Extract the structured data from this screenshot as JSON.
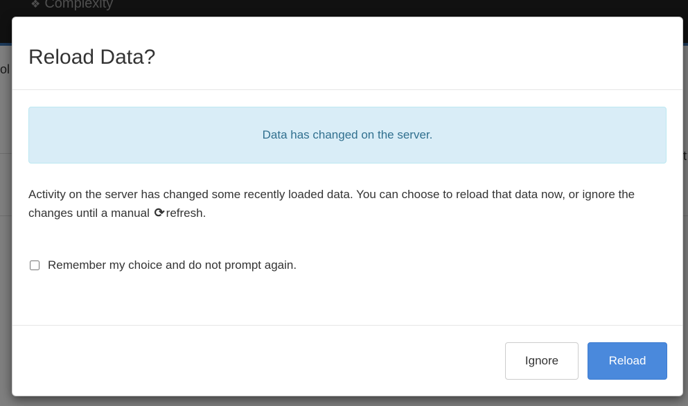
{
  "background": {
    "app_name": "Complexity",
    "left_fragment": "ol",
    "right_fragment": "t"
  },
  "dialog": {
    "title": "Reload Data?",
    "alert_text": "Data has changed on the server.",
    "body_text_before_icon": "Activity on the server has changed some recently loaded data. You can choose to reload that data now, or ignore the changes until a manual",
    "body_text_after_icon": "refresh.",
    "checkbox_label": "Remember my choice and do not prompt again.",
    "checkbox_checked": false,
    "ignore_label": "Ignore",
    "reload_label": "Reload"
  },
  "icons": {
    "brand": "cubes-icon",
    "refresh": "refresh-icon"
  },
  "colors": {
    "alert_bg": "#d9edf7",
    "alert_text": "#31708f",
    "primary": "#4a89dc"
  }
}
